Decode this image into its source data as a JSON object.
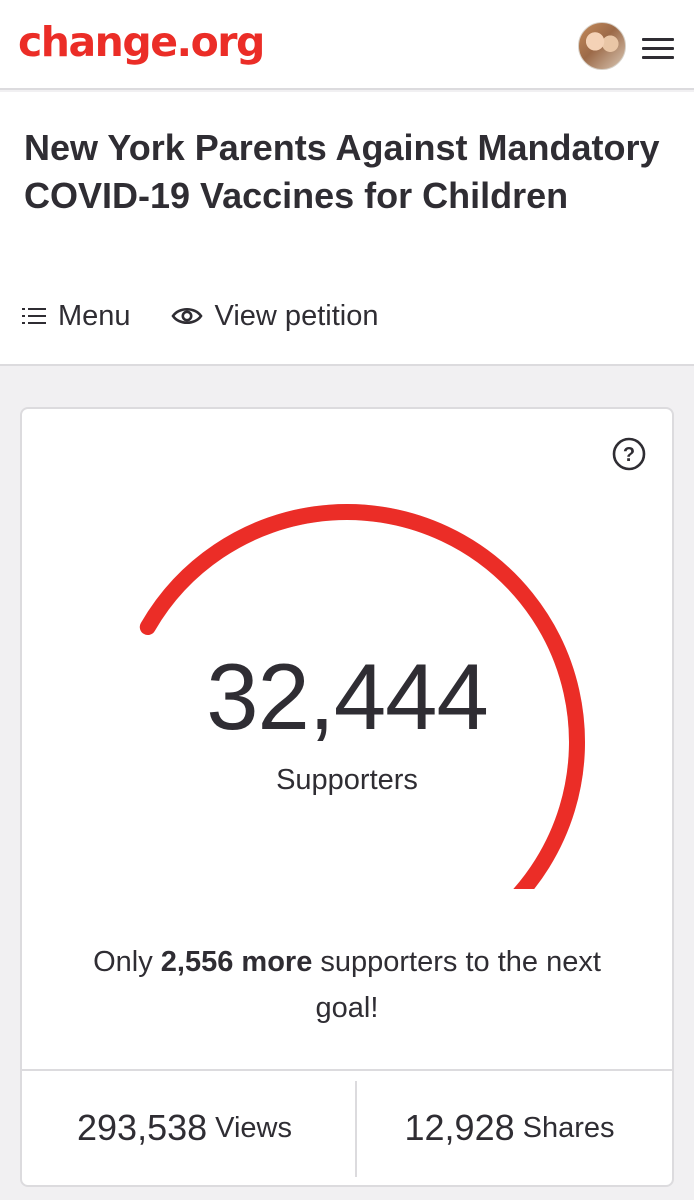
{
  "brand": {
    "logo_text": "change.org",
    "color": "#eb2d27"
  },
  "topbar": {
    "avatar": "user-avatar",
    "menu_icon": "hamburger-icon"
  },
  "petition": {
    "title": "New York Parents Against Mandatory COVID-19 Vaccines for Children",
    "subnav": {
      "menu_label": "Menu",
      "view_label": "View petition"
    }
  },
  "progress": {
    "count": "32,444",
    "count_label": "Supporters",
    "goal_prefix": "Only ",
    "goal_bold": "2,556 more",
    "goal_suffix": " supporters to the next goal!",
    "fill_fraction": 0.927,
    "fill_color": "#eb2d27",
    "track_color": "#dcdbde",
    "help_icon": "question-circle-icon"
  },
  "stats": {
    "views_value": "293,538",
    "views_label": "Views",
    "shares_value": "12,928",
    "shares_label": "Shares"
  }
}
